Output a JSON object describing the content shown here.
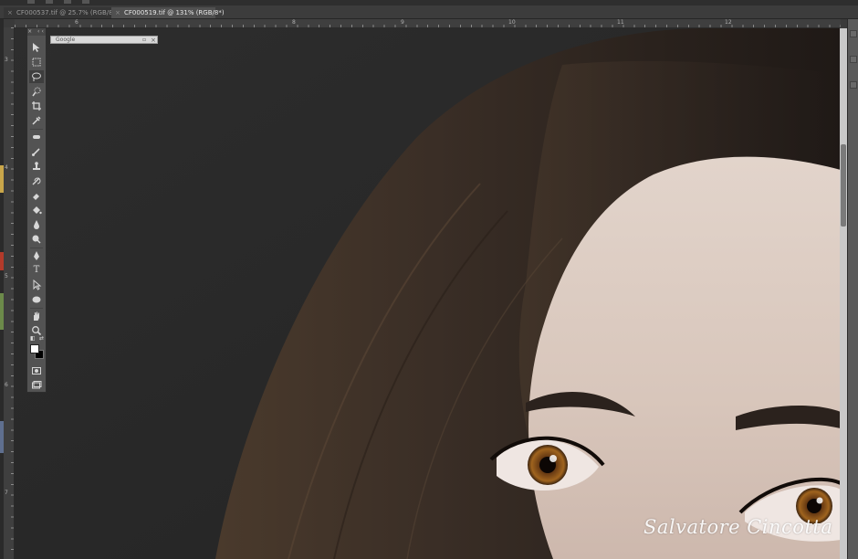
{
  "tabs": [
    {
      "label": "CF000537.tif @ 25.7% (RGB/8*)",
      "close": "×",
      "active": false
    },
    {
      "label": "CF000519.tif @ 131% (RGB/8*)",
      "close": "×",
      "active": true
    }
  ],
  "ruler": {
    "top_numbers": [
      "6",
      "8",
      "9",
      "10",
      "11",
      "12"
    ],
    "left_numbers": [
      "3",
      "4",
      "5",
      "6",
      "7"
    ]
  },
  "floating_panel": {
    "title": "Google",
    "minimize_glyph": "▫",
    "close_glyph": "×"
  },
  "toolbox": {
    "collapse_glyph": "× ‹‹",
    "tools": [
      {
        "name": "move-tool-icon",
        "glyph": "move"
      },
      {
        "name": "marquee-tool-icon",
        "glyph": "marquee"
      },
      {
        "name": "lasso-tool-icon",
        "glyph": "lasso"
      },
      {
        "name": "quick-select-tool-icon",
        "glyph": "quick"
      },
      {
        "name": "crop-tool-icon",
        "glyph": "crop"
      },
      {
        "name": "eyedropper-tool-icon",
        "glyph": "eyedropper"
      },
      {
        "name": "healing-brush-tool-icon",
        "glyph": "heal"
      },
      {
        "name": "brush-tool-icon",
        "glyph": "brush"
      },
      {
        "name": "clone-stamp-tool-icon",
        "glyph": "stamp"
      },
      {
        "name": "history-brush-tool-icon",
        "glyph": "history"
      },
      {
        "name": "eraser-tool-icon",
        "glyph": "eraser"
      },
      {
        "name": "paint-bucket-tool-icon",
        "glyph": "bucket"
      },
      {
        "name": "blur-tool-icon",
        "glyph": "blur"
      },
      {
        "name": "dodge-tool-icon",
        "glyph": "dodge"
      },
      {
        "name": "pen-tool-icon",
        "glyph": "pen"
      },
      {
        "name": "type-tool-icon",
        "glyph": "T"
      },
      {
        "name": "path-select-tool-icon",
        "glyph": "path"
      },
      {
        "name": "ellipse-tool-icon",
        "glyph": "ellipse"
      },
      {
        "name": "hand-tool-icon",
        "glyph": "hand"
      },
      {
        "name": "zoom-tool-icon",
        "glyph": "zoom"
      }
    ],
    "foreground_color": "#ffffff",
    "background_color": "#000000"
  },
  "watermark": {
    "text": "Salvatore Cincotta"
  },
  "colors": {
    "canvas_bg": "#262626",
    "ui_dark": "#3c3c3c",
    "active_tab": "#505050"
  }
}
